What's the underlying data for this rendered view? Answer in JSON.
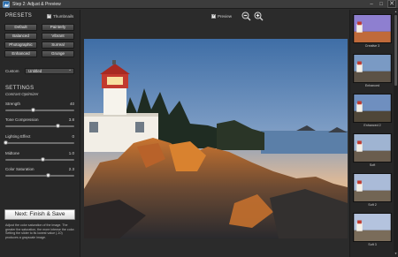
{
  "window": {
    "title": "Step 2: Adjust & Preview",
    "minimize_glyph": "‒",
    "maximize_glyph": "□",
    "close_glyph": "✕"
  },
  "presets": {
    "heading": "PRESETS",
    "thumbnails_label": "Thumbnails",
    "thumbnails_checked": true,
    "buttons": [
      "Default",
      "Painterly",
      "Balanced",
      "Vibrant",
      "Photographic",
      "Surreal",
      "Enhanced",
      "Grunge"
    ],
    "custom_label": "Custom",
    "custom_value": "Untitled",
    "chevron_glyph": "⌃"
  },
  "settings": {
    "heading": "SETTINGS",
    "subtitle": "Contrast Optimizer",
    "sliders": [
      {
        "label": "Strength",
        "value": "40",
        "level": 0.4
      },
      {
        "label": "Tone Compression",
        "value": "3.8",
        "level": 0.76
      },
      {
        "label": "Lighting Effect",
        "value": "0",
        "level": 0.0
      },
      {
        "label": "Midtone",
        "value": "1.0",
        "level": 0.55
      },
      {
        "label": "Color Saturation",
        "value": "2.3",
        "level": 0.62
      }
    ]
  },
  "finish_button": "Next: Finish & Save",
  "help_text": "Adjust the color saturation of the image. The greater the saturation, the more intense the color. Setting the slider to its lowest value (-10) produces a grayscale image.",
  "toolbar": {
    "preview_label": "Preview",
    "preview_checked": true
  },
  "thumbnails": [
    {
      "label": "Creative 3",
      "sky": "#8e7fd0",
      "ground": "#c06a3a"
    },
    {
      "label": "Enhanced",
      "sky": "#7a9ac4",
      "ground": "#5c5246"
    },
    {
      "label": "Enhanced 2",
      "sky": "#6f8fbf",
      "ground": "#4f4638"
    },
    {
      "label": "Soft",
      "sky": "#9fb4d2",
      "ground": "#6a5d4e"
    },
    {
      "label": "Soft 2",
      "sky": "#aabbd8",
      "ground": "#726554"
    },
    {
      "label": "Soft 3",
      "sky": "#b4c3de",
      "ground": "#7a6c5a"
    }
  ],
  "colors": {
    "accent": "#ffffff",
    "panel": "#282828",
    "button": "#4a4a4a"
  }
}
